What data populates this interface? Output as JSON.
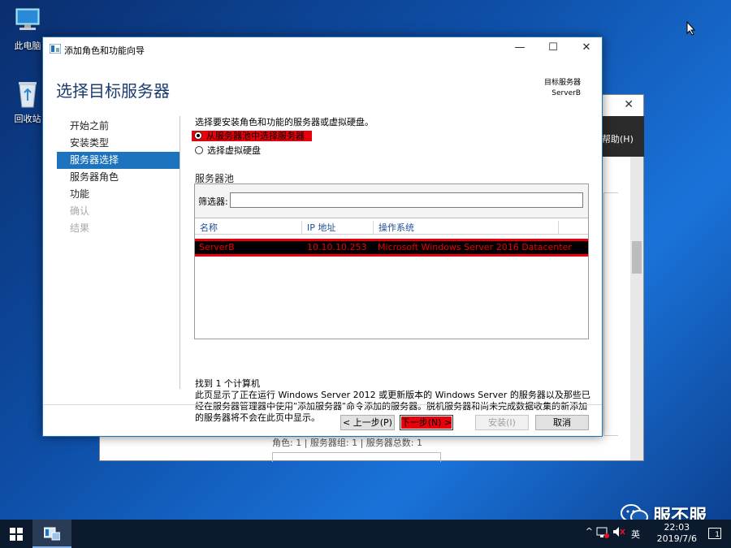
{
  "desktop": {
    "icons": [
      {
        "label": "此电脑"
      },
      {
        "label": "回收站"
      }
    ]
  },
  "background_window": {
    "menu_label": "帮助(H)",
    "status_text": "角色: 1 | 服务器组: 1 | 服务器总数: 1"
  },
  "wizard": {
    "window_title": "添加角色和功能向导",
    "heading": "选择目标服务器",
    "destination_label": "目标服务器",
    "destination_value": "ServerB",
    "nav": [
      {
        "label": "开始之前"
      },
      {
        "label": "安装类型"
      },
      {
        "label": "服务器选择"
      },
      {
        "label": "服务器角色"
      },
      {
        "label": "功能"
      },
      {
        "label": "确认"
      },
      {
        "label": "结果"
      }
    ],
    "instruction": "选择要安装角色和功能的服务器或虚拟硬盘。",
    "radio_pool": "从服务器池中选择服务器",
    "radio_vhd": "选择虚拟硬盘",
    "pool_section": "服务器池",
    "filter_label": "筛选器:",
    "filter_value": "",
    "columns": {
      "name": "名称",
      "ip": "IP 地址",
      "os": "操作系统"
    },
    "rows": [
      {
        "name": "ServerB",
        "ip": "10.10.10.253",
        "os": "Microsoft Windows Server 2016 Datacenter"
      }
    ],
    "found_text": "找到 1 个计算机",
    "note_text": "此页显示了正在运行 Windows Server 2012 或更新版本的 Windows Server 的服务器以及那些已经在服务器管理器中使用\"添加服务器\"命令添加的服务器。脱机服务器和尚未完成数据收集的新添加的服务器将不会在此页中显示。",
    "buttons": {
      "prev": "< 上一步(P)",
      "next": "下一步(N) >",
      "install": "安装(I)",
      "cancel": "取消"
    }
  },
  "taskbar": {
    "ime": "英",
    "time": "22:03",
    "date": "2019/7/6",
    "notification_count": "1"
  },
  "watermark": "服不服",
  "colors": {
    "highlight_red": "#e8000b",
    "selection_blue": "#1e73be"
  }
}
